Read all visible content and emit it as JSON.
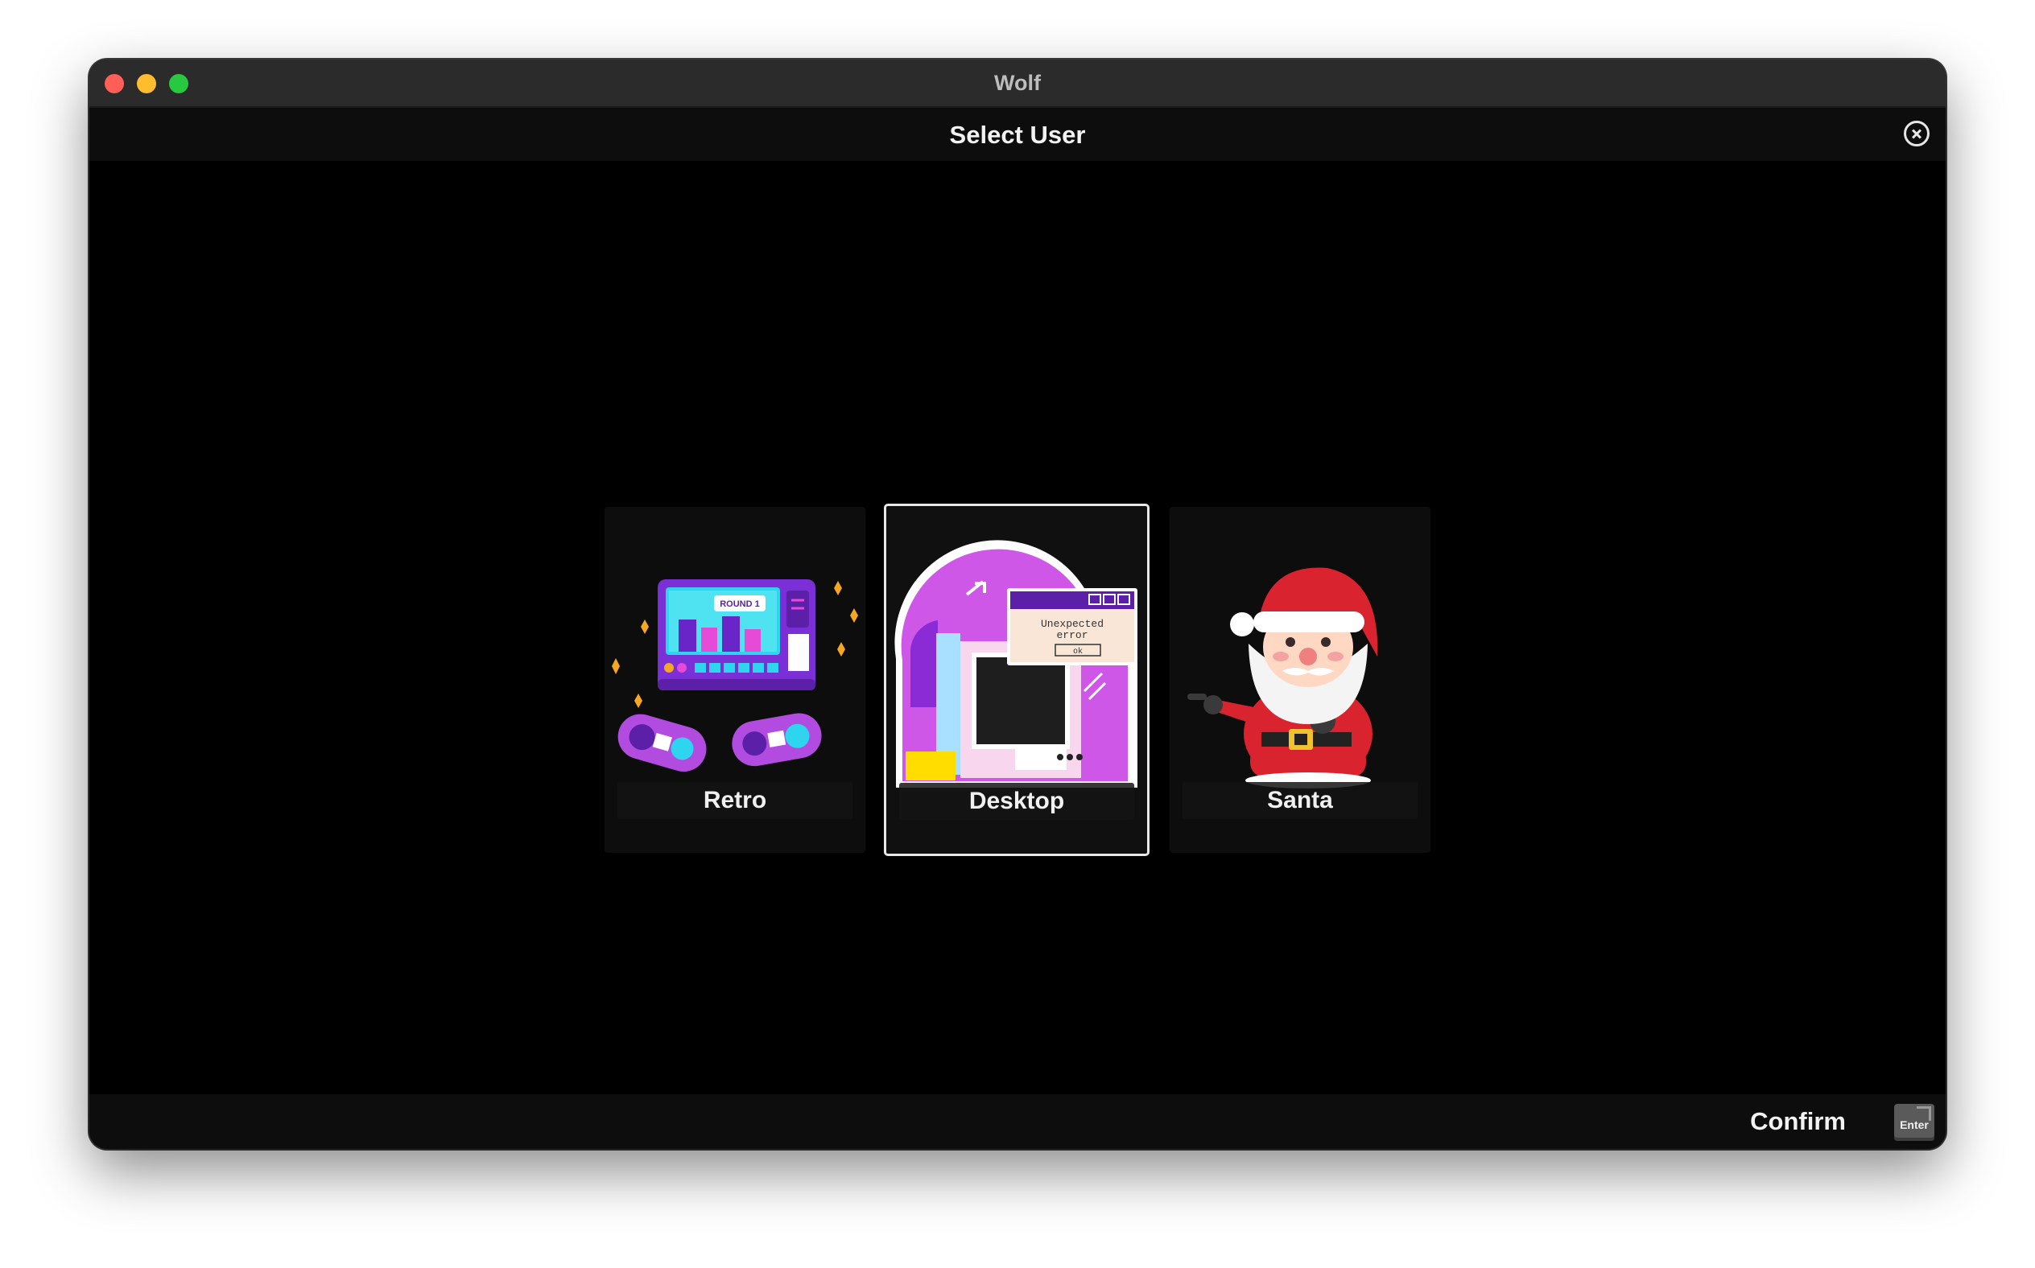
{
  "window": {
    "title": "Wolf",
    "traffic_lights": [
      "close",
      "minimize",
      "zoom"
    ]
  },
  "header": {
    "title": "Select User",
    "close_icon": "circle-x-icon"
  },
  "users": [
    {
      "name": "Retro",
      "avatar": "retro-arcade-avatar",
      "selected": false
    },
    {
      "name": "Desktop",
      "avatar": "desktop-error-avatar",
      "selected": true
    },
    {
      "name": "Santa",
      "avatar": "santa-claus-avatar",
      "selected": false
    }
  ],
  "desktop_avatar": {
    "dialog_text_line1": "Unexpected",
    "dialog_text_line2": "error",
    "dialog_button": "ok"
  },
  "retro_avatar": {
    "screen_text": "ROUND 1"
  },
  "footer": {
    "confirm_label": "Confirm",
    "key_label": "Enter"
  },
  "colors": {
    "selected_border": "#e8e8e8",
    "card_bg": "#0d0d0d",
    "accent_purple": "#b24be0",
    "accent_pink": "#e54bd6"
  }
}
